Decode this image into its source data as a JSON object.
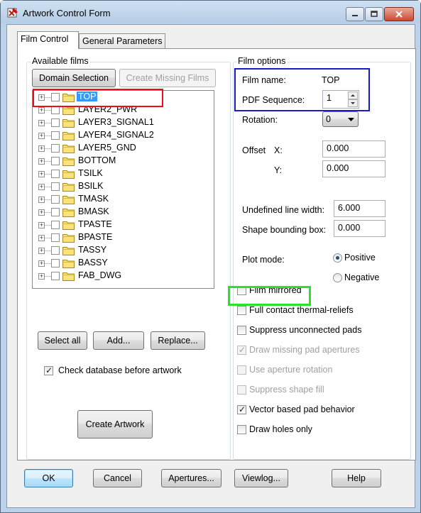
{
  "window": {
    "title": "Artwork Control Form"
  },
  "tabs": [
    {
      "label": "Film Control"
    },
    {
      "label": "General Parameters"
    }
  ],
  "available_films": {
    "group_label": "Available films",
    "domain_selection_label": "Domain Selection",
    "create_missing_label": "Create Missing Films",
    "films": [
      {
        "name": "TOP",
        "selected": true
      },
      {
        "name": "LAYER2_PWR"
      },
      {
        "name": "LAYER3_SIGNAL1"
      },
      {
        "name": "LAYER4_SIGNAL2"
      },
      {
        "name": "LAYER5_GND"
      },
      {
        "name": "BOTTOM"
      },
      {
        "name": "TSILK"
      },
      {
        "name": "BSILK"
      },
      {
        "name": "TMASK"
      },
      {
        "name": "BMASK"
      },
      {
        "name": "TPASTE"
      },
      {
        "name": "BPASTE"
      },
      {
        "name": "TASSY"
      },
      {
        "name": "BASSY"
      },
      {
        "name": "FAB_DWG"
      }
    ],
    "select_all_label": "Select all",
    "add_label": "Add...",
    "replace_label": "Replace...",
    "check_database_label": "Check database before artwork",
    "check_database_checked": true,
    "create_artwork_label": "Create Artwork"
  },
  "film_options": {
    "group_label": "Film options",
    "film_name_label": "Film name:",
    "film_name_value": "TOP",
    "pdf_sequence_label": "PDF Sequence:",
    "pdf_sequence_value": "1",
    "rotation_label": "Rotation:",
    "rotation_value": "0",
    "offset_label": "Offset",
    "offset_x_label": "X:",
    "offset_x_value": "0.000",
    "offset_y_label": "Y:",
    "offset_y_value": "0.000",
    "undefined_line_width_label": "Undefined line width:",
    "undefined_line_width_value": "6.000",
    "shape_bounding_box_label": "Shape bounding box:",
    "shape_bounding_box_value": "0.000",
    "plot_mode_label": "Plot mode:",
    "positive_label": "Positive",
    "negative_label": "Negative",
    "plot_mode_selected": "Positive",
    "options": [
      {
        "label": "Film mirrored",
        "checked": false,
        "enabled": true
      },
      {
        "label": "Full contact thermal-reliefs",
        "checked": false,
        "enabled": true
      },
      {
        "label": "Suppress unconnected pads",
        "checked": false,
        "enabled": true
      },
      {
        "label": "Draw missing pad apertures",
        "checked": true,
        "enabled": false
      },
      {
        "label": "Use aperture rotation",
        "checked": false,
        "enabled": false
      },
      {
        "label": "Suppress shape fill",
        "checked": false,
        "enabled": false
      },
      {
        "label": "Vector based pad behavior",
        "checked": true,
        "enabled": true
      },
      {
        "label": "Draw holes only",
        "checked": false,
        "enabled": true
      }
    ]
  },
  "footer": {
    "ok_label": "OK",
    "cancel_label": "Cancel",
    "apertures_label": "Apertures...",
    "viewlog_label": "Viewlog...",
    "help_label": "Help"
  },
  "colors": {
    "highlight_red": "#e8101a",
    "highlight_blue": "#1a1ac8",
    "highlight_green": "#2de02d",
    "selection": "#3399ff"
  },
  "icons": [
    "app-icon",
    "minimize-icon",
    "maximize-icon",
    "close-icon",
    "folder-icon",
    "expand-icon",
    "spin-up-icon",
    "spin-down-icon",
    "dropdown-arrow-icon"
  ]
}
